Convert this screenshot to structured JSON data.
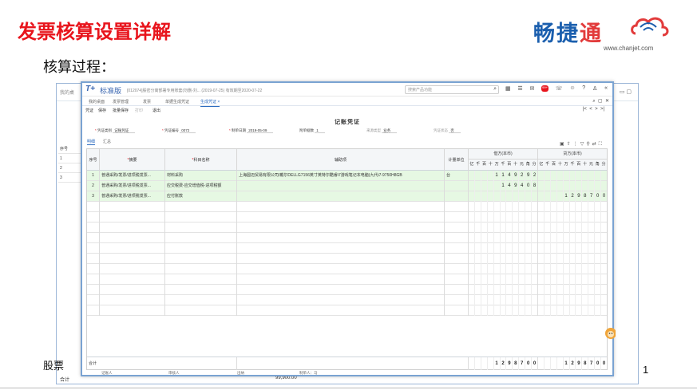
{
  "slide": {
    "title": "发票核算设置详解",
    "subtitle": "核算过程：",
    "footer_text": "股票",
    "page_number": "1",
    "logo_text_1": "畅捷",
    "logo_text_2": "通",
    "logo_url": "www.chanjet.com"
  },
  "app": {
    "brand": "T+",
    "version": "标准版",
    "account": "[012074]股密分离部署专用账套(勿删-刘...     (2019-07-25) 有效期至2020-07-22",
    "search_placeholder": "搜索产品功能",
    "badge": "99+"
  },
  "tabs": [
    "我的桌面",
    "发票管理",
    "发票",
    "单据生成凭证",
    "生成凭证"
  ],
  "toolbar": [
    "凭证",
    "保存",
    "批量保存",
    "打印",
    "退出"
  ],
  "voucher": {
    "title": "记账凭证",
    "fields": {
      "type_label": "凭证类别",
      "type_value": "记账凭证",
      "no_label": "凭证编号",
      "no_value": "0072",
      "date_label": "制单日期",
      "date_value": "2019-05-09",
      "attach_label": "附单据数",
      "attach_value": "1",
      "source_label": "来源类型",
      "source_value": "业务",
      "audit_label": "凭证状态",
      "audit_value": "否"
    },
    "subtabs": [
      "明细",
      "汇总"
    ]
  },
  "table": {
    "headers": {
      "seq": "序号",
      "summary": "摘要",
      "account": "科目名称",
      "aux": "辅助项",
      "unit": "计量单位",
      "debit": "借方(本币)",
      "credit": "贷方(本币)"
    },
    "digit_labels": [
      "亿",
      "千",
      "百",
      "十",
      "万",
      "千",
      "百",
      "十",
      "元",
      "角",
      "分"
    ],
    "rows": [
      {
        "seq": "1",
        "summary": "普通采购/发票/进项税发票...",
        "account": "材料采购",
        "aux": "上海圆迈贸易有限公司/戴尔DELLG7156英寸英特尔酷睿i7游戏笔记本电脑(九代i7-9750H8GB",
        "unit": "台",
        "debit": "114929 2",
        "credit": ""
      },
      {
        "seq": "2",
        "summary": "普通采购/发票/进项税发票...",
        "account": "应交税费-应交增值税-进项税额",
        "aux": "",
        "unit": "",
        "debit": "149408",
        "credit": ""
      },
      {
        "seq": "3",
        "summary": "普通采购/发票/进项税发票...",
        "account": "应付账款",
        "aux": "",
        "unit": "",
        "debit": "",
        "credit": "1298700"
      }
    ],
    "total_label": "合计",
    "total_debit": "1298700",
    "total_credit": "1298700"
  },
  "footer": {
    "bookkeeper": "记账人",
    "auditor": "审核人",
    "cashier": "出纳",
    "maker": "制单人：马"
  },
  "background_window": {
    "side_rows": [
      "序号",
      "1",
      "2",
      "3"
    ],
    "total_label": "合计",
    "total_value": "99,900.00",
    "corner_label": "我的桌"
  }
}
